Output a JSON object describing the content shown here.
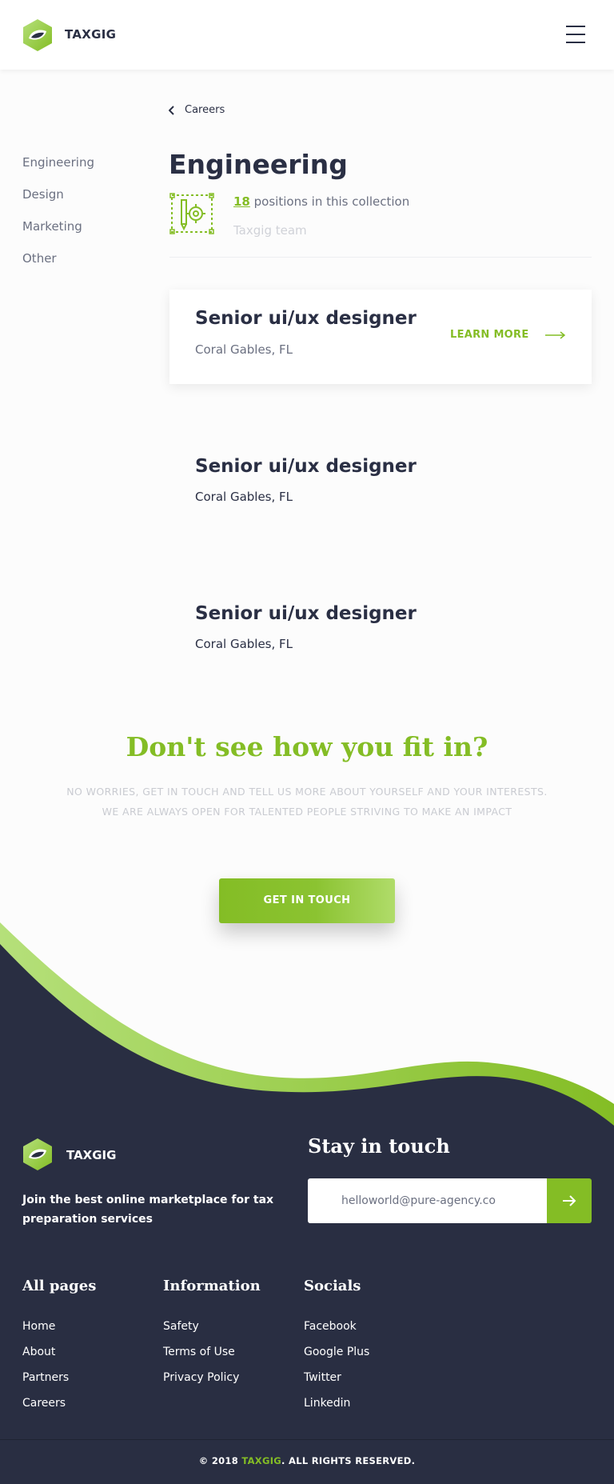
{
  "header": {
    "brand": "TAXGIG",
    "menu_icon": "hamburger-menu-icon"
  },
  "sidebar": {
    "items": [
      "Engineering",
      "Design",
      "Marketing",
      "Other"
    ]
  },
  "breadcrumb": {
    "label": "Careers"
  },
  "collection": {
    "title": "Engineering",
    "count": "18",
    "count_suffix": "positions in this collection",
    "team": "Taxgig team"
  },
  "jobs": [
    {
      "title": "Senior ui/ux designer",
      "location": "Coral Gables, FL",
      "cta": "LEARN MORE"
    },
    {
      "title": "Senior ui/ux designer",
      "location": "Coral Gables, FL"
    },
    {
      "title": "Senior ui/ux designer",
      "location": "Coral Gables, FL"
    }
  ],
  "cta": {
    "title": "Don't see how you fit in?",
    "line1": "NO WORRIES, GET IN TOUCH AND TELL US MORE ABOUT YOURSELF AND YOUR INTERESTS.",
    "line2": "WE ARE ALWAYS OPEN FOR TALENTED PEOPLE STRIVING TO MAKE AN IMPACT",
    "button": "GET IN TOUCH"
  },
  "footer": {
    "brand": "TAXGIG",
    "description": "Join the best online marketplace for tax preparation services",
    "stay_title": "Stay in touch",
    "email_value": "helloworld@pure-agency.co",
    "columns": [
      {
        "title": "All pages",
        "links": [
          "Home",
          "About",
          "Partners",
          "Careers"
        ]
      },
      {
        "title": "Information",
        "links": [
          "Safety",
          "Terms of Use",
          "Privacy Policy"
        ]
      },
      {
        "title": "Socials",
        "links": [
          "Facebook",
          "Google Plus",
          "Twitter",
          "Linkedin"
        ]
      }
    ],
    "copyright_prefix": "© 2018",
    "copyright_brand": "TAXGIG",
    "copyright_suffix": ". ALL RIGHTS RESERVED."
  },
  "colors": {
    "accent": "#84bd25",
    "dark": "#2a2f44",
    "light_green": "#b5e07a"
  }
}
